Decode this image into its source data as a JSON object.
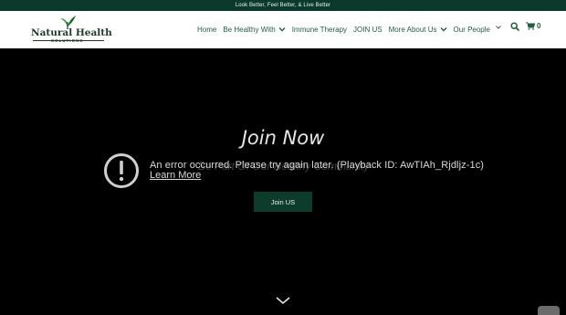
{
  "announcement": {
    "text": "Look Better, Feel Better, & Live Better"
  },
  "brand": {
    "name": "Natural Health",
    "tagline": "SOLUTIONS"
  },
  "nav": {
    "items": [
      {
        "label": "Home"
      },
      {
        "label": "Be Healthy With"
      },
      {
        "label": "Immune Therapy"
      },
      {
        "label": "JOIN US"
      },
      {
        "label": "More About Us"
      },
      {
        "label": "Our People"
      }
    ],
    "cart_count": "0"
  },
  "hero": {
    "title": "Join Now",
    "subtitle": "Be Part Of Our Healthy Community",
    "button_label": "Join US"
  },
  "video_error": {
    "message": "An error occurred. Please try again later. (Playback ID: AwTIAh_Rjdljz-1c)",
    "link_label": "Learn More"
  },
  "colors": {
    "brand_dark_green": "#0b3a2c",
    "nav_green": "#1f5e3e",
    "hero_bg": "#000000"
  },
  "icons": [
    "leaf-logo-icon",
    "chevron-down-icon",
    "search-icon",
    "cart-icon",
    "alert-circle-icon",
    "scroll-down-chevron-icon",
    "youtube-icon"
  ]
}
